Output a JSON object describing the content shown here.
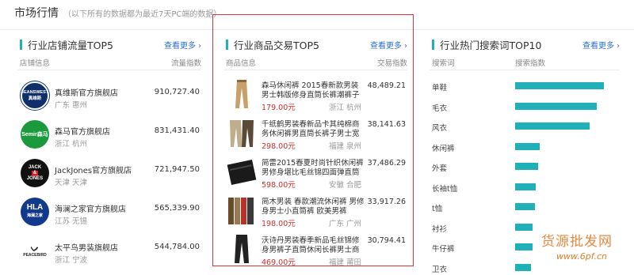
{
  "header": {
    "title": "市场行情",
    "subtitle": "（以下所有的数据都为最近7天PC端的数据）"
  },
  "store_panel": {
    "title": "行业店铺流量TOP5",
    "more_label": "查看更多",
    "col_left": "店铺信息",
    "col_right": "流量指数",
    "rows": [
      {
        "logo": "JEANSWEST",
        "logo_sub": "真维斯",
        "name": "真维斯官方旗舰店",
        "location": "广东 惠州",
        "value": "910,727.40"
      },
      {
        "logo": "Semir森马",
        "name": "森马官方旗舰店",
        "location": "浙江 杭州",
        "value": "831,431.40"
      },
      {
        "logo": "JACK",
        "logo_mid": "&",
        "logo_sub": "JONES",
        "name": "JackJones官方旗舰店",
        "location": "天津 天津",
        "value": "721,947.50"
      },
      {
        "logo": "HLA",
        "logo_sub": "海澜之家",
        "name": "海澜之家官方旗舰店",
        "location": "江苏 无锡",
        "value": "565,339.90"
      },
      {
        "logo": "PEACEBIRD",
        "name": "太平鸟男装旗舰店",
        "location": "浙江 宁波",
        "value": "544,784.00"
      }
    ]
  },
  "goods_panel": {
    "title": "行业商品交易TOP5",
    "more_label": "查看更多",
    "col_left": "商品信息",
    "col_right": "交易指数",
    "rows": [
      {
        "name": "森马休闲裤 2015春新款男装男士韩版修身直筒长裤潮裤子",
        "price": "179.00元",
        "location": "浙江 杭州",
        "value": "48,489.21"
      },
      {
        "name": "千纸鹤男装春新品卡其纯棉商务休闲裤男直筒长裤子男士宽",
        "price": "298.00元",
        "location": "福建 泉州",
        "value": "38,141.63"
      },
      {
        "name": "简雷2015春夏时尚针织休闲裤男修身堪比毛丝锦四面弹直筒",
        "price": "598.00元",
        "location": "安徽 合肥",
        "value": "37,486.29"
      },
      {
        "name": "简木男装 春款潮流休闲裤 男修身男士小直筒裤 欧美男裤",
        "price": "198.00元",
        "location": "广东 广州",
        "value": "33,917.26"
      },
      {
        "name": "沃诗丹男装春季新品毛丝锦修身男裤子直筒休闲长裤男士商",
        "price": "469.00元",
        "location": "福建 莆田",
        "value": "30,794.41"
      }
    ]
  },
  "search_panel": {
    "title": "行业热门搜索词TOP10",
    "more_label": "查看更多",
    "col_left": "搜索词",
    "col_right": "搜索指数",
    "rows": [
      {
        "word": "单鞋",
        "level": 1.0
      },
      {
        "word": "毛衣",
        "level": 0.92
      },
      {
        "word": "风衣",
        "level": 0.84
      },
      {
        "word": "休闲裤",
        "level": 0.28
      },
      {
        "word": "外套",
        "level": 0.26
      },
      {
        "word": "长袖t恤",
        "level": 0.23
      },
      {
        "word": "t恤",
        "level": 0.22
      },
      {
        "word": "衬衫",
        "level": 0.2
      },
      {
        "word": "牛仔裤",
        "level": 0.2
      },
      {
        "word": "卫衣",
        "level": 0.18
      }
    ]
  },
  "watermark": {
    "text": "货源批发网",
    "url_text": "www.6pf.cn"
  },
  "colors": {
    "accent": "#1fb0b8",
    "link": "#2a6fd1",
    "price": "#d42b2b",
    "highlight_frame": "#e0333a",
    "watermark": "#e77b2a"
  }
}
